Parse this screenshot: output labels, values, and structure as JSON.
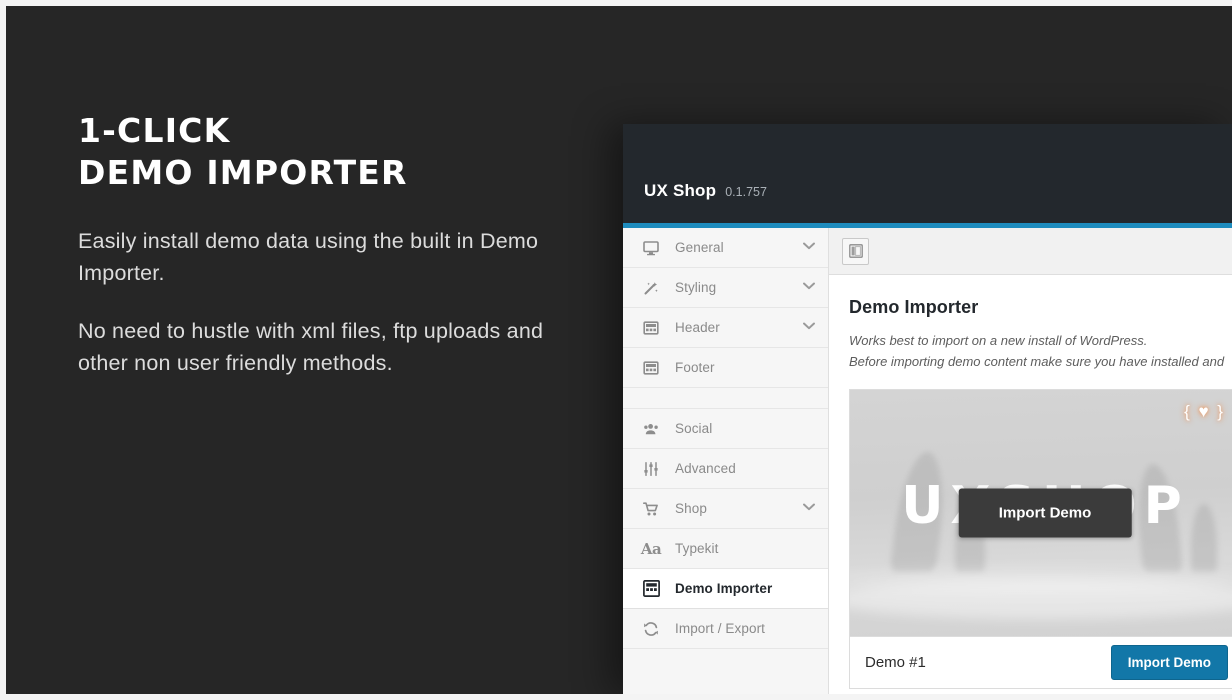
{
  "promo": {
    "heading_line1": "1-Click",
    "heading_line2": "Demo Importer",
    "paragraph1": "Easily install demo data using the built in Demo Importer.",
    "paragraph2": "No need to hustle with xml files, ftp uploads and other non user friendly methods."
  },
  "panel": {
    "title": "UX Shop",
    "version": "0.1.757",
    "accent_color": "#1e8cbe"
  },
  "sidebar": {
    "items": [
      {
        "label": "General",
        "icon": "monitor-icon",
        "chevron": "⌄",
        "active": false
      },
      {
        "label": "Styling",
        "icon": "magic-wand-icon",
        "chevron": "⌄",
        "active": false
      },
      {
        "label": "Header",
        "icon": "layout-top-icon",
        "chevron": "⌄",
        "active": false
      },
      {
        "label": "Footer",
        "icon": "layout-bottom-icon",
        "chevron": "",
        "active": false
      },
      {
        "label": "Social",
        "icon": "users-icon",
        "chevron": "",
        "active": false
      },
      {
        "label": "Advanced",
        "icon": "sliders-icon",
        "chevron": "",
        "active": false
      },
      {
        "label": "Shop",
        "icon": "cart-icon",
        "chevron": "⌄",
        "active": false
      },
      {
        "label": "Typekit",
        "icon": "aa-type-icon",
        "chevron": "",
        "active": false
      },
      {
        "label": "Demo Importer",
        "icon": "demo-window-icon",
        "chevron": "",
        "active": true
      },
      {
        "label": "Import / Export",
        "icon": "refresh-icon",
        "chevron": "",
        "active": false
      }
    ]
  },
  "toolbar": {
    "expand_icon": "panel-layout-icon"
  },
  "content": {
    "title": "Demo Importer",
    "desc_line1": "Works best to import on a new install of WordPress.",
    "desc_line2": "Before importing demo content make sure you have installed and"
  },
  "demo_card": {
    "thumb_wordmark": "UXSHOP",
    "thumb_badge": "{ ♥ }",
    "overlay_button": "Import Demo",
    "name": "Demo #1",
    "import_button": "Import Demo",
    "button_color": "#1277a8"
  }
}
